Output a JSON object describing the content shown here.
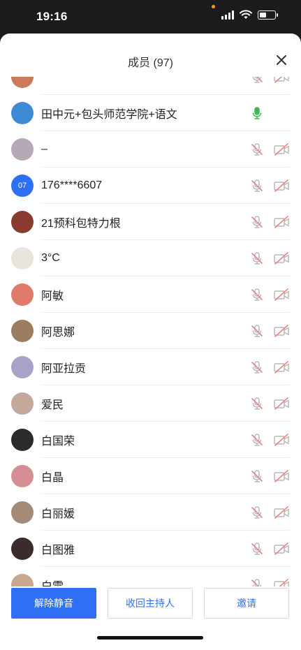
{
  "status_bar": {
    "time": "19:16"
  },
  "panel": {
    "title": "成员 (97)"
  },
  "members": [
    {
      "name": "",
      "avatar_text": "",
      "avatar_color": "#c97b5a",
      "mic": "muted",
      "partial": true
    },
    {
      "name": "田中元+包头师范学院+语文",
      "avatar_text": "",
      "avatar_color": "#3d8bd4",
      "mic": "active"
    },
    {
      "name": "–",
      "avatar_text": "",
      "avatar_color": "#b6a8b4",
      "mic": "muted"
    },
    {
      "name": "176****6607",
      "avatar_text": "07",
      "avatar_color": "#2f6ff6",
      "mic": "muted"
    },
    {
      "name": "21预科包特力根",
      "avatar_text": "",
      "avatar_color": "#8a3a2e",
      "mic": "muted"
    },
    {
      "name": "3°C",
      "avatar_text": "",
      "avatar_color": "#e9e4dc",
      "mic": "muted"
    },
    {
      "name": "阿敏",
      "avatar_text": "",
      "avatar_color": "#e07a6a",
      "mic": "muted"
    },
    {
      "name": "阿思娜",
      "avatar_text": "",
      "avatar_color": "#9b7e62",
      "mic": "muted"
    },
    {
      "name": "阿亚拉贡",
      "avatar_text": "",
      "avatar_color": "#a9a2c8",
      "mic": "muted"
    },
    {
      "name": "爱民",
      "avatar_text": "",
      "avatar_color": "#c4a89a",
      "mic": "muted"
    },
    {
      "name": "白国荣",
      "avatar_text": "",
      "avatar_color": "#2b2b2b",
      "mic": "muted"
    },
    {
      "name": "白晶",
      "avatar_text": "",
      "avatar_color": "#d48e94",
      "mic": "muted"
    },
    {
      "name": "白丽媛",
      "avatar_text": "",
      "avatar_color": "#a58a78",
      "mic": "muted"
    },
    {
      "name": "白图雅",
      "avatar_text": "",
      "avatar_color": "#3a2c2c",
      "mic": "muted"
    },
    {
      "name": "白雪",
      "avatar_text": "",
      "avatar_color": "#c9a890",
      "mic": "muted"
    }
  ],
  "footer": {
    "unmute_all_label": "解除静音",
    "reclaim_host_label": "收回主持人",
    "invite_label": "邀请"
  },
  "colors": {
    "accent": "#2f6ff6",
    "mic_active": "#3cba54",
    "muted_red": "#f08080"
  }
}
